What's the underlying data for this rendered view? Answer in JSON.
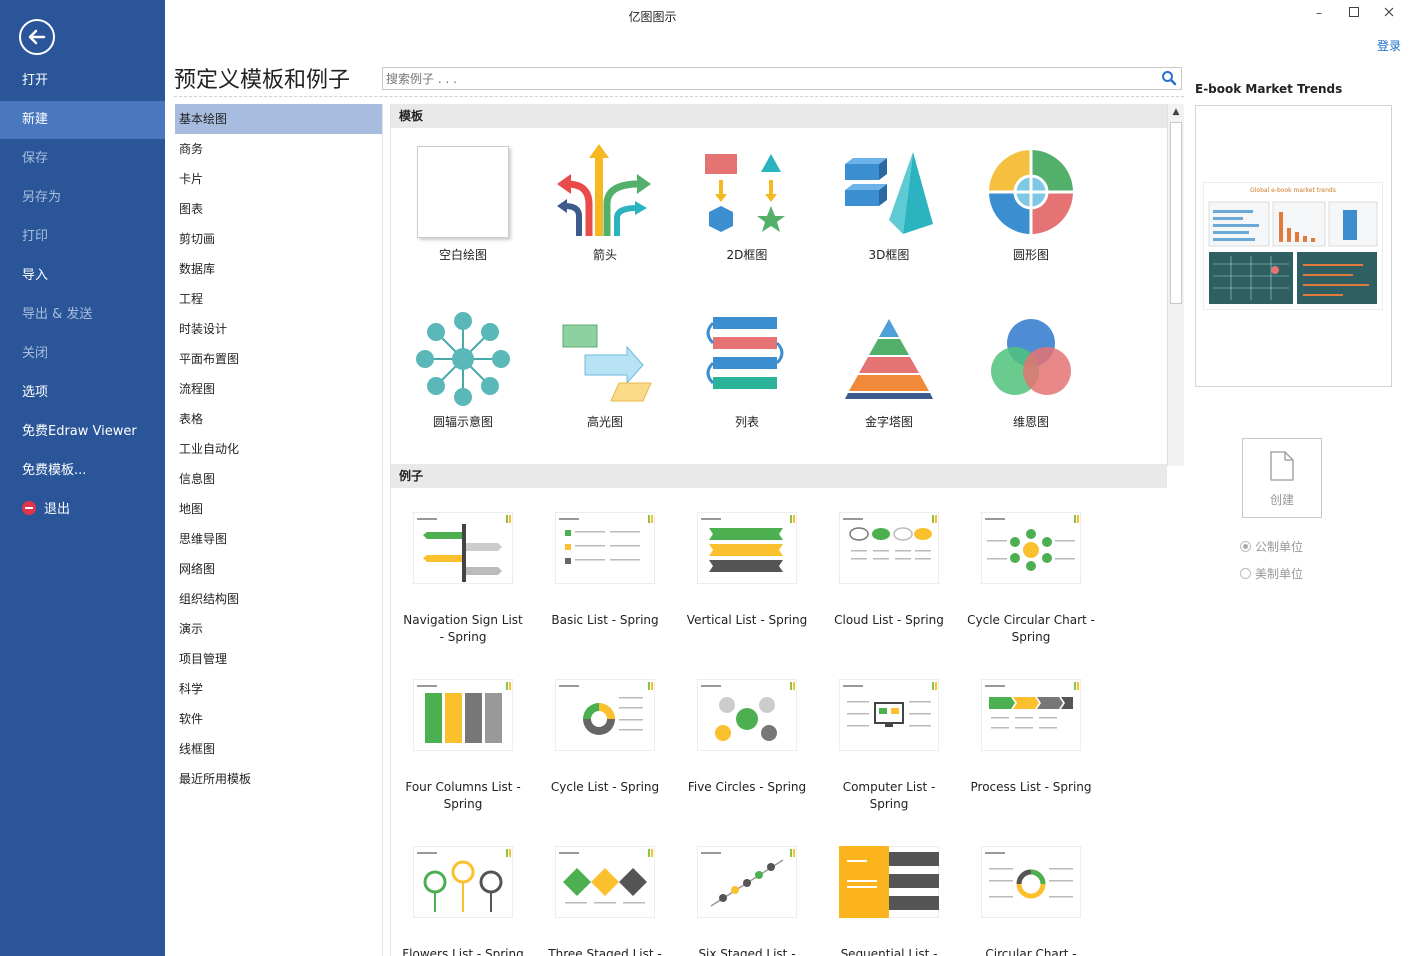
{
  "app": {
    "title": "亿图图示",
    "login": "登录"
  },
  "nav": {
    "items": [
      {
        "label": "打开",
        "dim": false
      },
      {
        "label": "新建",
        "dim": false,
        "active": true
      },
      {
        "label": "保存",
        "dim": true
      },
      {
        "label": "另存为",
        "dim": true
      },
      {
        "label": "打印",
        "dim": true
      },
      {
        "label": "导入",
        "dim": false
      },
      {
        "label": "导出 & 发送",
        "dim": true
      },
      {
        "label": "关闭",
        "dim": true
      },
      {
        "label": "选项",
        "dim": false
      },
      {
        "label": "免费Edraw Viewer",
        "dim": false
      },
      {
        "label": "免费模板...",
        "dim": false
      }
    ],
    "exit": "退出"
  },
  "header": {
    "heading": "预定义模板和例子",
    "search_placeholder": "搜索例子 . . ."
  },
  "categories": [
    "基本绘图",
    "商务",
    "卡片",
    "图表",
    "剪切画",
    "数据库",
    "工程",
    "时装设计",
    "平面布置图",
    "流程图",
    "表格",
    "工业自动化",
    "信息图",
    "地图",
    "思维导图",
    "网络图",
    "组织结构图",
    "演示",
    "项目管理",
    "科学",
    "软件",
    "线框图",
    "最近所用模板"
  ],
  "templates": {
    "title": "模板",
    "items": [
      "空白绘图",
      "箭头",
      "2D框图",
      "3D框图",
      "圆形图",
      "圆辐示意图",
      "高光图",
      "列表",
      "金字塔图",
      "维恩图"
    ]
  },
  "examples": {
    "title": "例子",
    "items": [
      [
        "Navigation Sign List",
        "- Spring"
      ],
      [
        "Basic List - Spring",
        ""
      ],
      [
        "Vertical List - Spring",
        ""
      ],
      [
        "Cloud List - Spring",
        ""
      ],
      [
        "Cycle Circular Chart -",
        "Spring"
      ],
      [
        "Four Columns List -",
        "Spring"
      ],
      [
        "Cycle List - Spring",
        ""
      ],
      [
        "Five Circles - Spring",
        ""
      ],
      [
        "Computer List -",
        "Spring"
      ],
      [
        "Process List - Spring",
        ""
      ],
      [
        "Flowers List - Spring",
        ""
      ],
      [
        "Three Staged List -",
        ""
      ],
      [
        "Six Staged List -",
        ""
      ],
      [
        "Sequential List -",
        ""
      ],
      [
        "Circular Chart -",
        ""
      ]
    ]
  },
  "preview": {
    "title": "E-book Market Trends",
    "thumb_title": "Global e-book market trends",
    "create": "创建",
    "units": [
      {
        "label": "公制单位",
        "selected": true
      },
      {
        "label": "美制单位",
        "selected": false
      }
    ]
  },
  "colors": {
    "nav_bg": "#2a5699",
    "nav_active": "#4a78c0",
    "cat_active": "#a8bce0",
    "link": "#1e6fc6"
  }
}
